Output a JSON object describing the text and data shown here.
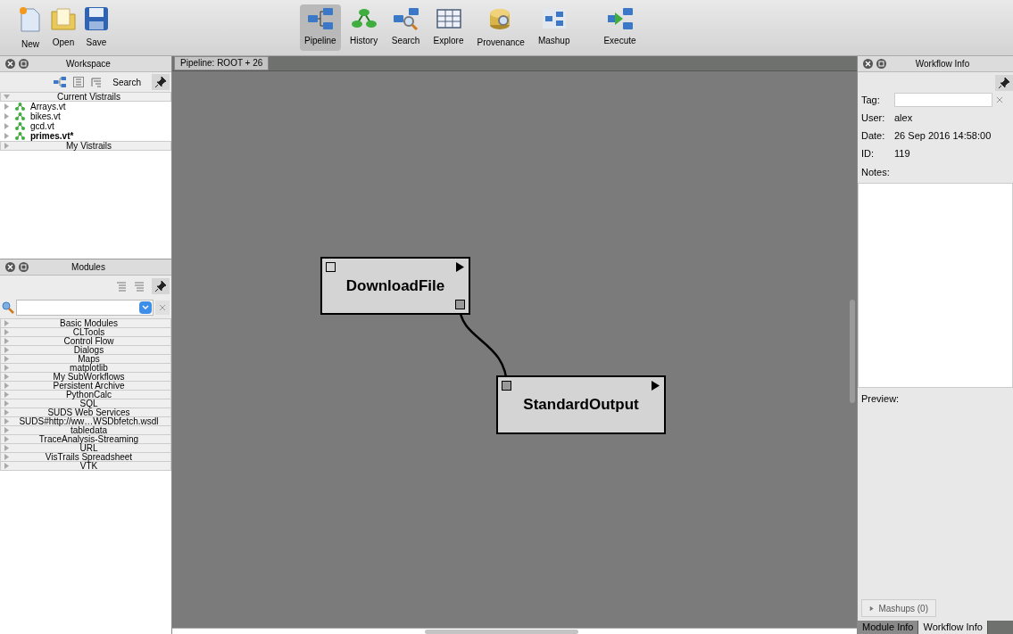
{
  "toolbar": {
    "left": [
      {
        "label": "New"
      },
      {
        "label": "Open"
      },
      {
        "label": "Save"
      }
    ],
    "views": [
      {
        "label": "Pipeline",
        "selected": true
      },
      {
        "label": "History",
        "selected": false
      },
      {
        "label": "Search",
        "selected": false
      },
      {
        "label": "Explore",
        "selected": false
      },
      {
        "label": "Provenance",
        "selected": false
      },
      {
        "label": "Mashup",
        "selected": false
      }
    ],
    "execute": {
      "label": "Execute"
    }
  },
  "workspace": {
    "title": "Workspace",
    "search_label": "Search",
    "sections": [
      {
        "label": "Current Vistrails",
        "expanded": true,
        "items": [
          {
            "label": "Arrays.vt",
            "current": false
          },
          {
            "label": "bikes.vt",
            "current": false
          },
          {
            "label": "gcd.vt",
            "current": false
          },
          {
            "label": "primes.vt*",
            "current": true
          }
        ]
      },
      {
        "label": "My Vistrails",
        "expanded": false
      }
    ]
  },
  "modules": {
    "title": "Modules",
    "packages": [
      {
        "label": "Basic Modules",
        "expanded": false
      },
      {
        "label": "CLTools",
        "expanded": false
      },
      {
        "label": "Control Flow",
        "expanded": false
      },
      {
        "label": "Dialogs",
        "expanded": false
      },
      {
        "label": "Maps",
        "expanded": false
      },
      {
        "label": "matplotlib",
        "expanded": false
      },
      {
        "label": "My SubWorkflows",
        "expanded": false
      },
      {
        "label": "Persistent Archive",
        "expanded": false
      },
      {
        "label": "PythonCalc",
        "expanded": false
      },
      {
        "label": "SQL",
        "expanded": false
      },
      {
        "label": "SUDS Web Services",
        "expanded": false
      },
      {
        "label": "SUDS#http://ww…WSDbfetch.wsdl",
        "expanded": false
      },
      {
        "label": "tabledata",
        "expanded": false
      },
      {
        "label": "TraceAnalysis-Streaming",
        "expanded": false
      },
      {
        "label": "URL",
        "expanded": false
      },
      {
        "label": "VisTrails Spreadsheet",
        "expanded": false
      },
      {
        "label": "VTK",
        "expanded": false
      }
    ]
  },
  "pipeline": {
    "tab": "Pipeline: ROOT + 26",
    "nodes": [
      {
        "label": "DownloadFile"
      },
      {
        "label": "StandardOutput"
      }
    ]
  },
  "workflow_info": {
    "title": "Workflow Info",
    "fields": [
      {
        "label": "Tag:"
      },
      {
        "label": "User:",
        "value": "alex"
      },
      {
        "label": "Date:",
        "value": "26 Sep 2016 14:58:00"
      },
      {
        "label": "ID:",
        "value": "119"
      }
    ],
    "notes_label": "Notes:",
    "preview_label": "Preview:",
    "mashups": "Mashups (0)"
  },
  "bottom_tabs": [
    {
      "label": "Module Info",
      "selected": false
    },
    {
      "label": "Workflow Info",
      "selected": true
    }
  ]
}
